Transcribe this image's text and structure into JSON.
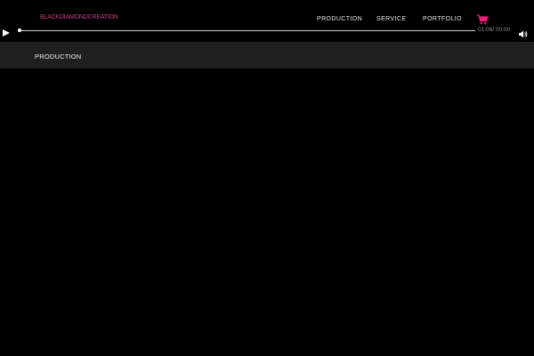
{
  "header": {
    "brand": "BLACKDIAMONDCREATION",
    "nav": {
      "production": "PRODUCTION",
      "service": "SERVICE",
      "portfolio": "PORTFOLIO"
    },
    "cart_icon": "cart-icon"
  },
  "player": {
    "play_icon": "play-icon",
    "volume_icon": "volume-icon",
    "current_time": "01:06",
    "separator": "/",
    "duration": "00:00",
    "progress": 0
  },
  "subheader": {
    "title": "PRODUCTION"
  },
  "colors": {
    "background": "#000000",
    "subbar": "#1f1f1f",
    "brand": "#c0407a",
    "accent": "#e8207a"
  }
}
